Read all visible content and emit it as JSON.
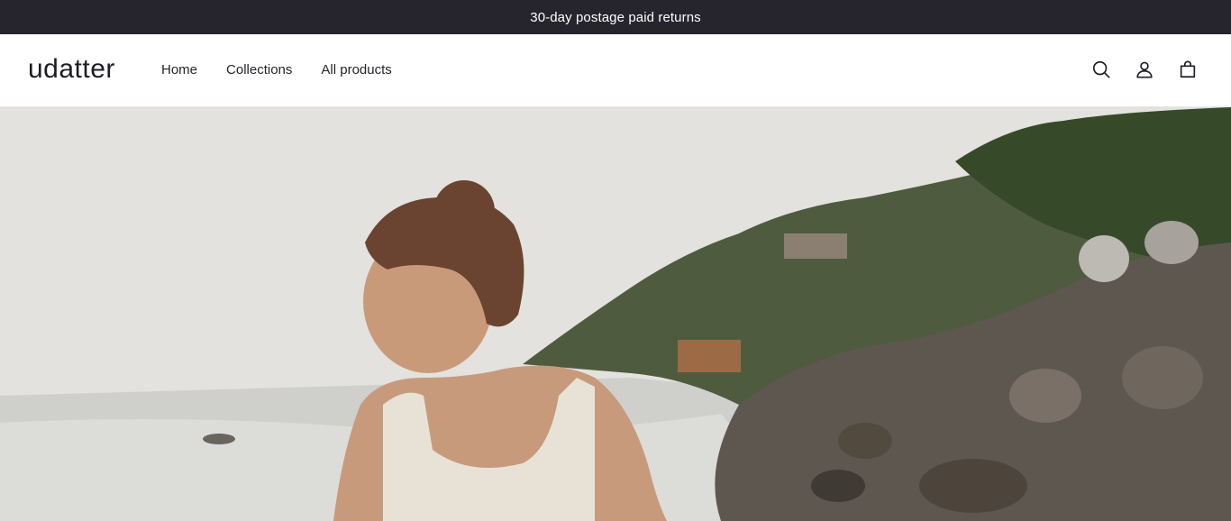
{
  "announcement": {
    "text": "30-day postage paid returns"
  },
  "header": {
    "logo": "udatter",
    "nav": [
      {
        "label": "Home"
      },
      {
        "label": "Collections"
      },
      {
        "label": "All products"
      }
    ],
    "icons": [
      "search-icon",
      "account-icon",
      "cart-icon"
    ]
  },
  "hero": {
    "image": "hero-image"
  },
  "colors": {
    "announcement_bg": "#26242c",
    "text": "#1f1d24",
    "header_bg": "#ffffff"
  }
}
